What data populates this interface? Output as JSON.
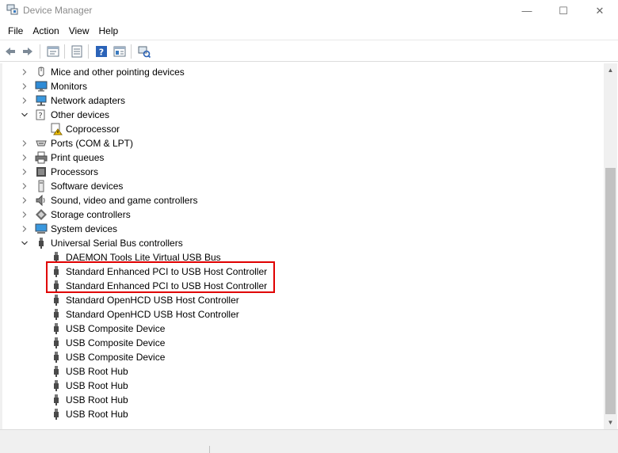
{
  "window": {
    "title": "Device Manager",
    "minimize_glyph": "—",
    "maximize_glyph": "☐",
    "close_glyph": "✕"
  },
  "menu": [
    "File",
    "Action",
    "View",
    "Help"
  ],
  "toolbar": {
    "icons": [
      "back-arrow-icon",
      "forward-arrow-icon",
      "properties-icon",
      "list-view-icon",
      "help-icon",
      "details-icon",
      "scan-hardware-icon"
    ]
  },
  "tree": [
    {
      "name": "Mice and other pointing devices",
      "level": 1,
      "state": "collapsed",
      "icon": "mouse-icon"
    },
    {
      "name": "Monitors",
      "level": 1,
      "state": "collapsed",
      "icon": "monitor-icon"
    },
    {
      "name": "Network adapters",
      "level": 1,
      "state": "collapsed",
      "icon": "network-icon"
    },
    {
      "name": "Other devices",
      "level": 1,
      "state": "expanded",
      "icon": "unknown-device-icon"
    },
    {
      "name": "Coprocessor",
      "level": 2,
      "state": "leaf",
      "icon": "warning-device-icon"
    },
    {
      "name": "Ports (COM & LPT)",
      "level": 1,
      "state": "collapsed",
      "icon": "port-icon"
    },
    {
      "name": "Print queues",
      "level": 1,
      "state": "collapsed",
      "icon": "printer-icon"
    },
    {
      "name": "Processors",
      "level": 1,
      "state": "collapsed",
      "icon": "processor-icon"
    },
    {
      "name": "Software devices",
      "level": 1,
      "state": "collapsed",
      "icon": "software-device-icon"
    },
    {
      "name": "Sound, video and game controllers",
      "level": 1,
      "state": "collapsed",
      "icon": "speaker-icon"
    },
    {
      "name": "Storage controllers",
      "level": 1,
      "state": "collapsed",
      "icon": "storage-icon"
    },
    {
      "name": "System devices",
      "level": 1,
      "state": "collapsed",
      "icon": "system-device-icon"
    },
    {
      "name": "Universal Serial Bus controllers",
      "level": 1,
      "state": "expanded",
      "icon": "usb-icon"
    },
    {
      "name": "DAEMON Tools Lite Virtual USB Bus",
      "level": 2,
      "state": "leaf",
      "icon": "usb-plug-icon"
    },
    {
      "name": "Standard Enhanced PCI to USB Host Controller",
      "level": 2,
      "state": "leaf",
      "icon": "usb-plug-icon"
    },
    {
      "name": "Standard Enhanced PCI to USB Host Controller",
      "level": 2,
      "state": "leaf",
      "icon": "usb-plug-icon"
    },
    {
      "name": "Standard OpenHCD USB Host Controller",
      "level": 2,
      "state": "leaf",
      "icon": "usb-plug-icon"
    },
    {
      "name": "Standard OpenHCD USB Host Controller",
      "level": 2,
      "state": "leaf",
      "icon": "usb-plug-icon"
    },
    {
      "name": "USB Composite Device",
      "level": 2,
      "state": "leaf",
      "icon": "usb-plug-icon"
    },
    {
      "name": "USB Composite Device",
      "level": 2,
      "state": "leaf",
      "icon": "usb-plug-icon"
    },
    {
      "name": "USB Composite Device",
      "level": 2,
      "state": "leaf",
      "icon": "usb-plug-icon"
    },
    {
      "name": "USB Root Hub",
      "level": 2,
      "state": "leaf",
      "icon": "usb-plug-icon"
    },
    {
      "name": "USB Root Hub",
      "level": 2,
      "state": "leaf",
      "icon": "usb-plug-icon"
    },
    {
      "name": "USB Root Hub",
      "level": 2,
      "state": "leaf",
      "icon": "usb-plug-icon"
    },
    {
      "name": "USB Root Hub",
      "level": 2,
      "state": "leaf",
      "icon": "usb-plug-icon"
    }
  ],
  "colors": {
    "highlight_border": "#e00000",
    "title_text": "#8a8a8a"
  }
}
